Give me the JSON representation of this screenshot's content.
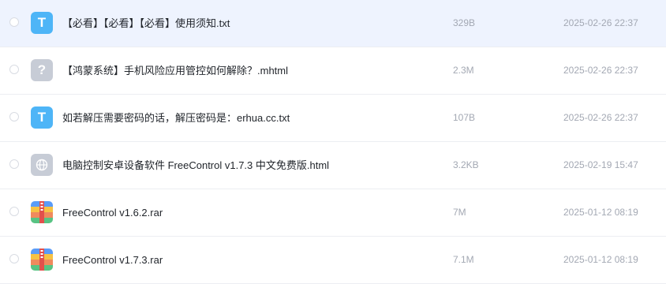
{
  "files": [
    {
      "name": "【必看】【必看】【必看】使用须知.txt",
      "type": "txt",
      "icon": "text-file-icon",
      "glyph": "T",
      "size": "329B",
      "date": "2025-02-26 22:37"
    },
    {
      "name": "【鸿蒙系统】手机风险应用管控如何解除？.mhtml",
      "type": "unknown",
      "icon": "unknown-file-icon",
      "glyph": "?",
      "size": "2.3M",
      "date": "2025-02-26 22:37"
    },
    {
      "name": "如若解压需要密码的话，解压密码是：erhua.cc.txt",
      "type": "txt",
      "icon": "text-file-icon",
      "glyph": "T",
      "size": "107B",
      "date": "2025-02-26 22:37"
    },
    {
      "name": "电脑控制安卓设备软件 FreeControl v1.7.3 中文免费版.html",
      "type": "html",
      "icon": "web-file-icon",
      "glyph": "",
      "size": "3.2KB",
      "date": "2025-02-19 15:47"
    },
    {
      "name": "FreeControl v1.6.2.rar",
      "type": "rar",
      "icon": "archive-file-icon",
      "glyph": "",
      "size": "7M",
      "date": "2025-01-12 08:19"
    },
    {
      "name": "FreeControl v1.7.3.rar",
      "type": "rar",
      "icon": "archive-file-icon",
      "glyph": "",
      "size": "7.1M",
      "date": "2025-01-12 08:19"
    }
  ],
  "colors": {
    "hover_row": "#eef3fe",
    "txt_icon": "#4eb5f7",
    "muted_text": "#a3a8b3"
  }
}
